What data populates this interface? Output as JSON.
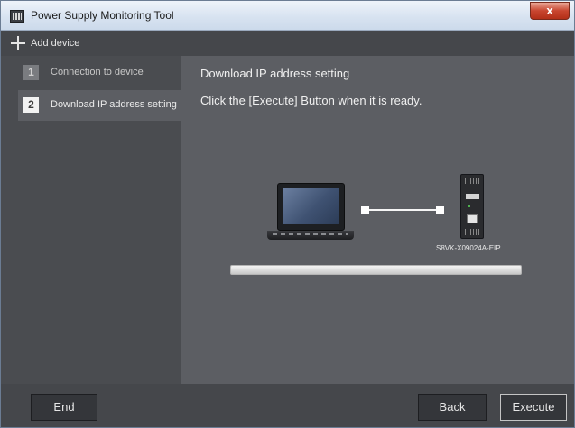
{
  "window": {
    "title": "Power Supply Monitoring Tool",
    "close_glyph": "x"
  },
  "toolbar": {
    "add_device_label": "Add device"
  },
  "steps": [
    {
      "number": "1",
      "label": "Connection to device",
      "active": false
    },
    {
      "number": "2",
      "label": "Download IP address setting",
      "active": true
    }
  ],
  "main": {
    "heading": "Download IP address setting",
    "instruction": "Click the [Execute] Button when it is ready.",
    "device_model": "S8VK-X09024A-EIP",
    "progress": 0
  },
  "footer": {
    "end_label": "End",
    "back_label": "Back",
    "execute_label": "Execute"
  },
  "icons": [
    "app-icon",
    "plus-icon",
    "laptop-icon",
    "power-supply-device-icon"
  ],
  "colors": {
    "titlebar": "#d8e3f1",
    "close_button": "#c8452f",
    "panel": "#5c5e63",
    "sidebar": "#4a4c50"
  }
}
